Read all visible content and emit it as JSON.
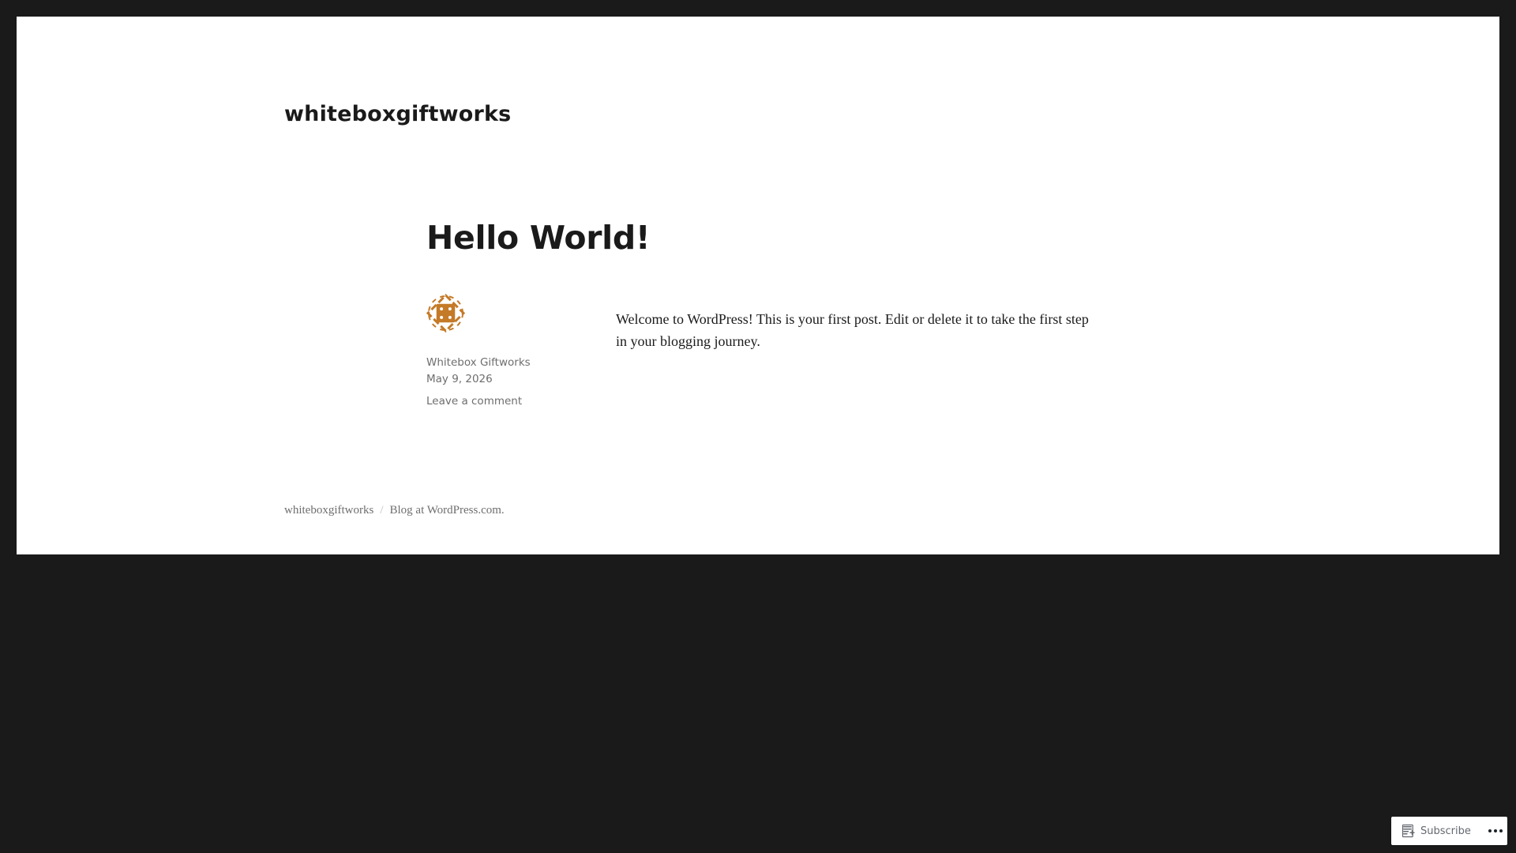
{
  "site": {
    "title": "whiteboxgiftworks"
  },
  "post": {
    "title": "Hello World!",
    "author": "Whitebox Giftworks",
    "date": "May 9, 2026",
    "comment_link": "Leave a comment",
    "content": "Welcome to WordPress! This is your first post. Edit or delete it to take the first step in your blogging journey."
  },
  "footer": {
    "site_link": "whiteboxgiftworks",
    "separator": "/",
    "credit": "Blog at WordPress.com."
  },
  "subscribe_bar": {
    "subscribe_label": "Subscribe",
    "subscribe_icon": "reader-icon",
    "more_icon": "ellipsis-icon"
  },
  "colors": {
    "page_background": "#1a1a1a",
    "content_background": "#ffffff",
    "text": "#1a1a1a",
    "meta_text": "#6e6e6e",
    "avatar_accent": "#c47a27"
  }
}
